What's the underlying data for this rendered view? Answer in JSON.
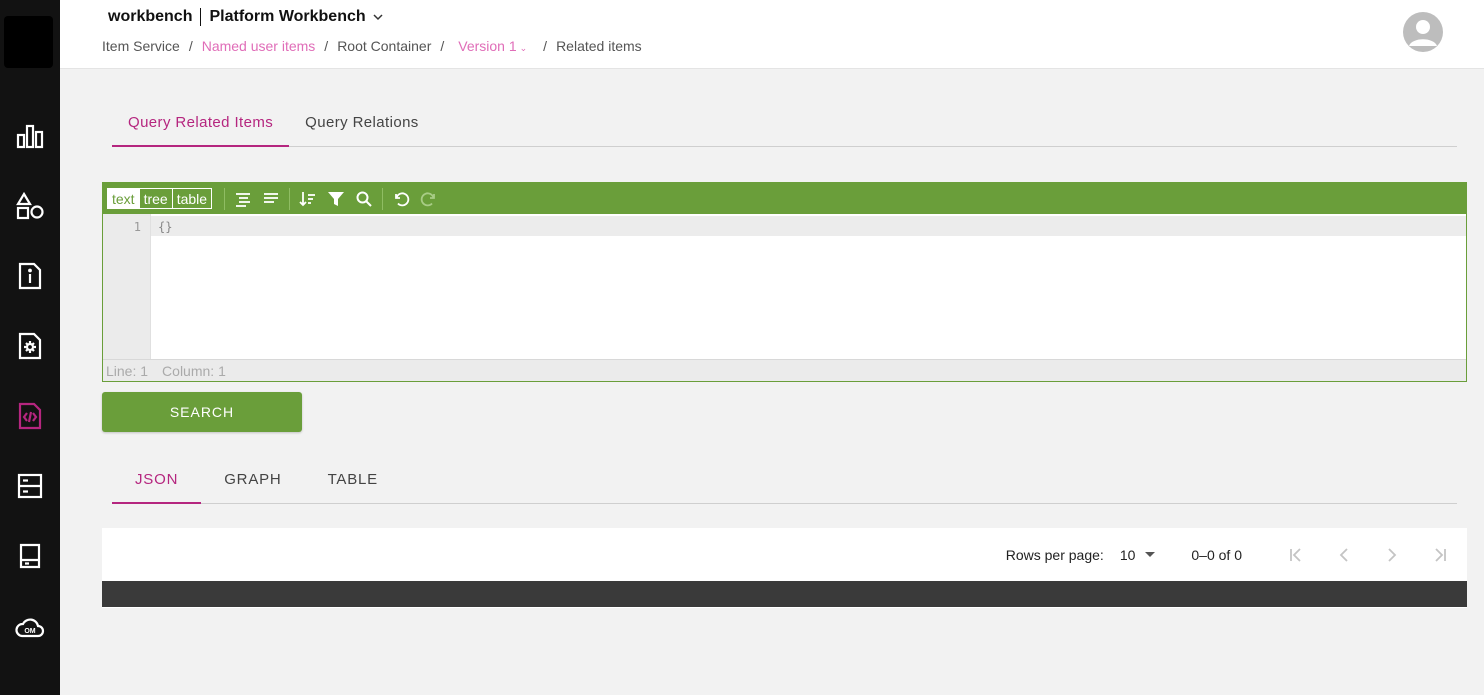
{
  "header": {
    "brand_left": "workbench",
    "brand_right": "Platform Workbench",
    "breadcrumb": [
      {
        "label": "Item Service",
        "link": false
      },
      {
        "label": "Named user items",
        "link": true
      },
      {
        "label": "Root Container",
        "link": false
      },
      {
        "label": "Version 1",
        "link": true
      },
      {
        "label": "Related items",
        "link": false
      }
    ]
  },
  "sidebar": {
    "items": [
      {
        "icon": "bar-chart-icon"
      },
      {
        "icon": "shapes-icon"
      },
      {
        "icon": "info-document-icon"
      },
      {
        "icon": "settings-document-icon"
      },
      {
        "icon": "code-document-icon",
        "active": true
      },
      {
        "icon": "server-icon"
      },
      {
        "icon": "storage-drive-icon"
      },
      {
        "icon": "cloud-om-icon",
        "label": "OM"
      }
    ]
  },
  "query_tabs": [
    "Query Related Items",
    "Query Relations"
  ],
  "editor": {
    "modes": [
      "text",
      "tree",
      "table"
    ],
    "selected_mode": "text",
    "line_number": "1",
    "code": "{}",
    "status_line": "Line: 1",
    "status_column": "Column: 1"
  },
  "search_button": "SEARCH",
  "result_tabs": [
    "JSON",
    "GRAPH",
    "TABLE"
  ],
  "pagination": {
    "rows_per_page_label": "Rows per page:",
    "rows_per_page_value": "10",
    "range": "0–0 of 0"
  },
  "colors": {
    "accent": "#b5267f",
    "link": "#e06db8",
    "editor_green": "#6a9e3a",
    "sidebar_bg": "#121212"
  }
}
